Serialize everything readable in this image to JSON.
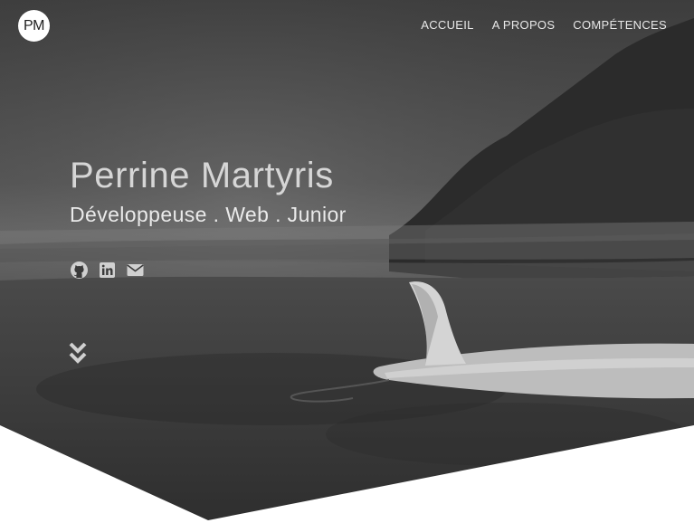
{
  "brand": {
    "logo_text": "PM"
  },
  "nav": {
    "items": [
      {
        "label": "ACCUEIL"
      },
      {
        "label": "A PROPOS"
      },
      {
        "label": "COMPÉTENCES"
      }
    ]
  },
  "hero": {
    "name": "Perrine Martyris",
    "subtitle": "Développeuse . Web . Junior",
    "social": [
      {
        "icon": "github-icon"
      },
      {
        "icon": "linkedin-icon"
      },
      {
        "icon": "envelope-icon"
      }
    ],
    "scroll_icon": "double-chevron-down-icon"
  },
  "colors": {
    "overlay": "#3a3a3a",
    "text_light": "#e6e6e6",
    "page_bg": "#ffffff"
  }
}
